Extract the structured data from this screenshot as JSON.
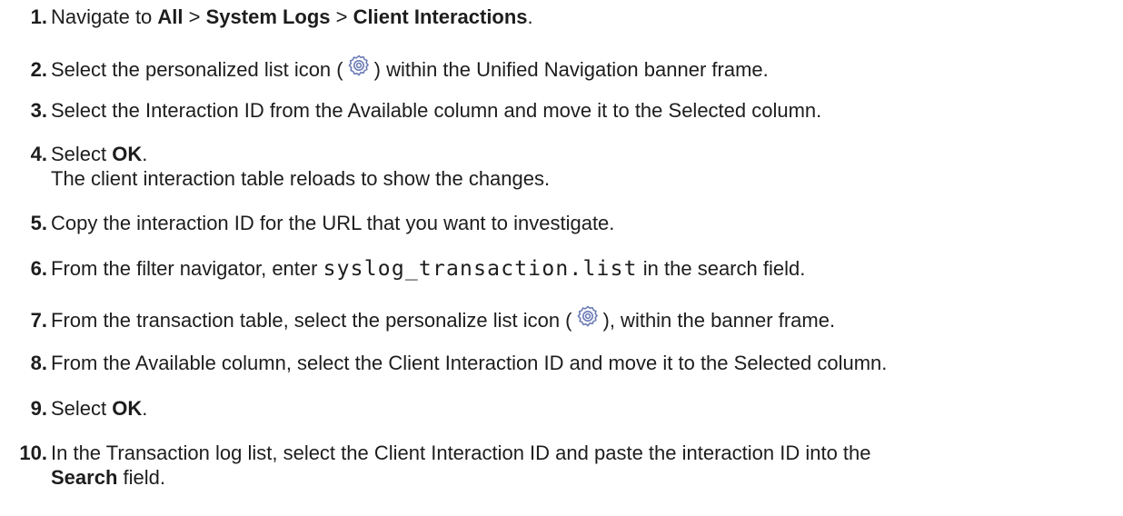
{
  "steps": [
    {
      "num": "1.",
      "text_a": "Navigate to ",
      "b1": "All",
      "text_b": " > ",
      "b2": "System Logs",
      "text_c": " > ",
      "b3": "Client Interactions",
      "text_d": "."
    },
    {
      "num": "2.",
      "text_a": "Select the personalized list icon (",
      "text_b": ") within the Unified Navigation banner frame.",
      "icon": "gear-icon"
    },
    {
      "num": "3.",
      "text": "Select the Interaction ID from the Available column and move it to the Selected column."
    },
    {
      "num": "4.",
      "text_a": "Select ",
      "bold": "OK",
      "text_b": ".",
      "line2": "The client interaction table reloads to show the changes."
    },
    {
      "num": "5.",
      "text": "Copy the interaction ID for the URL that you want to investigate."
    },
    {
      "num": "6.",
      "text_a": "From the filter navigator, enter ",
      "code": "syslog_transaction.list",
      "text_b": " in the search field."
    },
    {
      "num": "7.",
      "text_a": "From the transaction table, select the personalize list icon (",
      "text_b": "), within the banner frame.",
      "icon": "gear-icon"
    },
    {
      "num": "8.",
      "text": "From the Available column, select the Client Interaction ID and move it to the Selected column."
    },
    {
      "num": "9.",
      "text_a": "Select ",
      "bold": "OK",
      "text_b": "."
    },
    {
      "num": "10.",
      "text": "In the Transaction log list, select the Client Interaction ID and paste the interaction ID into the",
      "bold2": "Search",
      "text2": " field."
    }
  ],
  "colors": {
    "text": "#1d1d1d",
    "icon": "#6b7bb5"
  }
}
